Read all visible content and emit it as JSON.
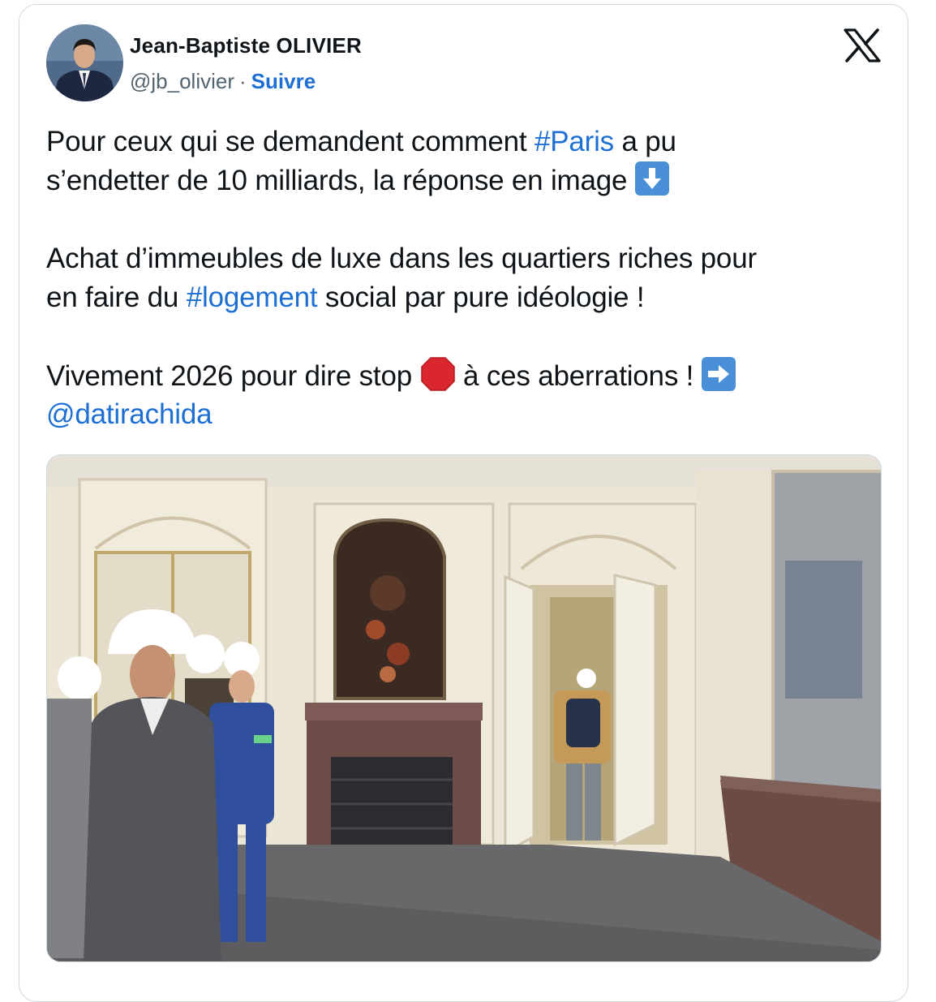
{
  "author": {
    "name": "Jean-Baptiste OLIVIER",
    "handle": "@jb_olivier",
    "separator": "·",
    "follow_label": "Suivre"
  },
  "tweet": {
    "l1_before": "Pour ceux qui se demandent comment ",
    "l1_tag": "#Paris",
    "l1_after": " a pu",
    "l2_text": "s’endetter de 10 milliards, la réponse en image ",
    "l4_text": "Achat d’immeubles de luxe dans les quartiers riches pour",
    "l5_before": "en faire du ",
    "l5_tag": "#logement",
    "l5_after": " social par pure idéologie !",
    "l7_before": "Vivement 2026 pour dire stop ",
    "l7_after": " à ces aberrations ! ",
    "l8_mention": "@datirachida"
  },
  "icons": {
    "logo": "x-logo-icon",
    "down_arrow": "down-arrow-emoji-icon",
    "stop_sign": "stop-sign-emoji-icon",
    "right_arrow": "right-arrow-emoji-icon"
  },
  "colors": {
    "link": "#1d6fd4",
    "text": "#0f1419",
    "muted": "#536471",
    "border": "#cfd9de",
    "emoji_blue": "#4a90d9",
    "stop_red": "#d9262f"
  }
}
